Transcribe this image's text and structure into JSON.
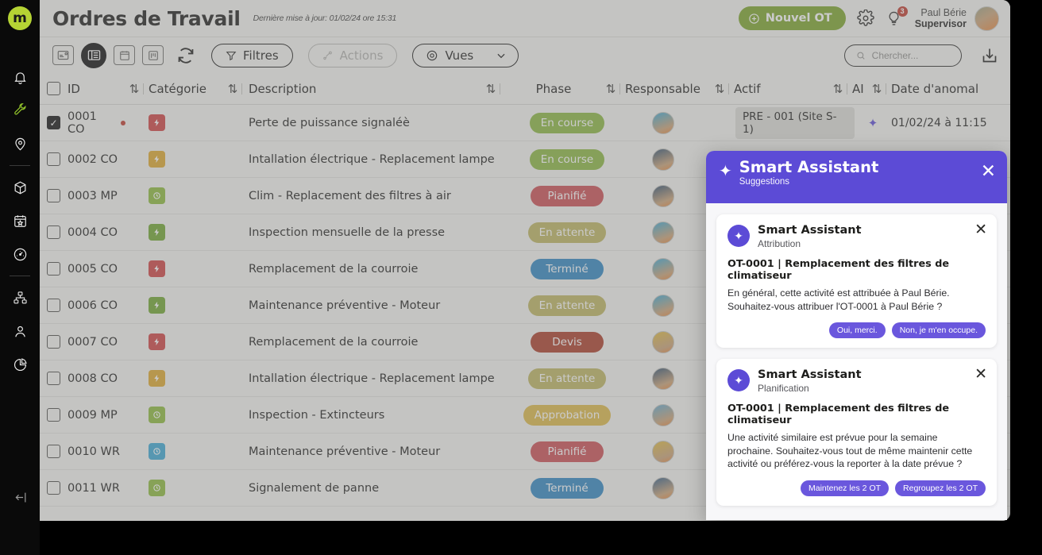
{
  "brand": {
    "logo_letter": "m",
    "accent_green": "#7ba428",
    "accent_purple": "#5c4bd6"
  },
  "sidebar": {
    "items": [
      {
        "name": "bell-icon",
        "label": "Notifications",
        "active": false
      },
      {
        "name": "wrench-icon",
        "label": "Maintenance",
        "active": true
      },
      {
        "name": "location-pin-icon",
        "label": "Sites",
        "active": false
      },
      {
        "name": "cube-icon",
        "label": "Actifs",
        "active": false
      },
      {
        "name": "calendar-star-icon",
        "label": "Planning",
        "active": false
      },
      {
        "name": "gauge-icon",
        "label": "Performance",
        "active": false
      },
      {
        "name": "hierarchy-icon",
        "label": "Organisation",
        "active": false
      },
      {
        "name": "user-icon",
        "label": "Utilisateurs",
        "active": false
      },
      {
        "name": "pie-chart-icon",
        "label": "Rapports",
        "active": false
      }
    ],
    "collapse_label": "Réduire"
  },
  "header": {
    "title": "Ordres de Travail",
    "subtitle": "Dernière mise à jour: 01/02/24 ore 15:31",
    "new_button": "Nouvel OT",
    "gear_icon": "gear-icon",
    "bulb_icon": "lightbulb-icon",
    "bulb_badge": "3",
    "user_name": "Paul Bérie",
    "user_role": "Supervisor"
  },
  "toolbar": {
    "views": [
      {
        "name": "card-view-icon",
        "active": false
      },
      {
        "name": "list-view-icon",
        "active": true
      },
      {
        "name": "calendar-view-icon",
        "active": false
      },
      {
        "name": "kanban-view-icon",
        "active": false
      }
    ],
    "refresh_icon": "refresh-icon",
    "filters_label": "Filtres",
    "actions_label": "Actions",
    "views_label": "Vues",
    "search_placeholder": "Chercher...",
    "search_value": "",
    "download_icon": "download-icon"
  },
  "table": {
    "columns": [
      {
        "key": "id",
        "label": "ID",
        "sortable": true
      },
      {
        "key": "category",
        "label": "Catégorie",
        "sortable": true
      },
      {
        "key": "description",
        "label": "Description",
        "sortable": true
      },
      {
        "key": "phase",
        "label": "Phase",
        "sortable": true
      },
      {
        "key": "responsable",
        "label": "Responsable",
        "sortable": true
      },
      {
        "key": "actif",
        "label": "Actif",
        "sortable": true
      },
      {
        "key": "ai",
        "label": "AI",
        "sortable": true
      },
      {
        "key": "date",
        "label": "Date d'anomal",
        "sortable": false
      }
    ],
    "select_all": false,
    "rows": [
      {
        "selected": true,
        "id": "0001 CO",
        "flag": true,
        "cat_icon": "bolt-icon",
        "cat_color": "#cf4040",
        "description": "Perte de puissance signaléè",
        "phase": "En course",
        "phase_color": "#8bb73f",
        "avatar_color": "#3aa8d4",
        "actif": "PRE - 001 (Site S-1)",
        "ai": true,
        "date": "01/02/24 à 11:15"
      },
      {
        "selected": false,
        "id": "0002 CO",
        "flag": false,
        "cat_icon": "bolt-icon",
        "cat_color": "#dfa82a",
        "description": "Intallation électrique - Replacement lampe",
        "phase": "En course",
        "phase_color": "#8bb73f",
        "avatar_color": "#2f4f6e",
        "actif": "",
        "ai": false,
        "date": ""
      },
      {
        "selected": false,
        "id": "0003 MP",
        "flag": false,
        "cat_icon": "clock-icon",
        "cat_color": "#8cbb3a",
        "description": "Clim - Replacement des filtres à air",
        "phase": "Pianifié",
        "phase_color": "#cb4c52",
        "avatar_color": "#2f4f6e",
        "actif": "",
        "ai": false,
        "date": ""
      },
      {
        "selected": false,
        "id": "0004 CO",
        "flag": false,
        "cat_icon": "bolt-icon",
        "cat_color": "#6fa52e",
        "description": "Inspection mensuelle de la presse",
        "phase": "En attente",
        "phase_color": "#bdb560",
        "avatar_color": "#3aa8d4",
        "actif": "",
        "ai": false,
        "date": ""
      },
      {
        "selected": false,
        "id": "0005 CO",
        "flag": false,
        "cat_icon": "bolt-icon",
        "cat_color": "#cf4040",
        "description": "Remplacement de la courroie",
        "phase": "Terminé",
        "phase_color": "#2e86c1",
        "avatar_color": "#3aa8d4",
        "actif": "",
        "ai": false,
        "date": ""
      },
      {
        "selected": false,
        "id": "0006 CO",
        "flag": false,
        "cat_icon": "bolt-icon",
        "cat_color": "#6fa52e",
        "description": "Maintenance préventive - Moteur",
        "phase": "En attente",
        "phase_color": "#bdb560",
        "avatar_color": "#3aa8d4",
        "actif": "",
        "ai": false,
        "date": ""
      },
      {
        "selected": false,
        "id": "0007 CO",
        "flag": false,
        "cat_icon": "bolt-icon",
        "cat_color": "#cf4040",
        "description": "Remplacement de la courroie",
        "phase": "Devis",
        "phase_color": "#ab3b26",
        "avatar_color": "#e0b93a",
        "actif": "",
        "ai": false,
        "date": ""
      },
      {
        "selected": false,
        "id": "0008 CO",
        "flag": false,
        "cat_icon": "bolt-icon",
        "cat_color": "#dfa82a",
        "description": "Intallation électrique - Replacement lampe",
        "phase": "En attente",
        "phase_color": "#bdb560",
        "avatar_color": "#2f4f6e",
        "actif": "",
        "ai": false,
        "date": ""
      },
      {
        "selected": false,
        "id": "0009 MP",
        "flag": false,
        "cat_icon": "clock-icon",
        "cat_color": "#8cbb3a",
        "description": "Inspection - Extincteurs",
        "phase": "Approbation",
        "phase_color": "#ddb846",
        "avatar_color": "#5fa8cf",
        "actif": "",
        "ai": false,
        "date": ""
      },
      {
        "selected": false,
        "id": "0010 WR",
        "flag": false,
        "cat_icon": "clock-icon",
        "cat_color": "#3aa8d4",
        "description": "Maintenance préventive - Moteur",
        "phase": "Pianifié",
        "phase_color": "#cb4c52",
        "avatar_color": "#e0b93a",
        "actif": "",
        "ai": false,
        "date": ""
      },
      {
        "selected": false,
        "id": "0011 WR",
        "flag": false,
        "cat_icon": "clock-icon",
        "cat_color": "#8cbb3a",
        "description": "Signalement de panne",
        "phase": "Terminé",
        "phase_color": "#2e86c1",
        "avatar_color": "#2e5a84",
        "actif": "",
        "ai": false,
        "date": ""
      }
    ]
  },
  "assistant": {
    "title": "Smart Assistant",
    "subtitle": "Suggestions",
    "close_icon": "close-icon",
    "cards": [
      {
        "name": "Smart Assistant",
        "kind": "Attribution",
        "subject": "OT-0001 | Remplacement des filtres de climatiseur",
        "text": "En général, cette activité est attribuée à Paul Bérie. Souhaitez-vous attribuer l'OT-0001 à Paul Bérie ?",
        "actions": [
          "Oui, merci.",
          "Non, je m'en occupe."
        ]
      },
      {
        "name": "Smart Assistant",
        "kind": "Planification",
        "subject": "OT-0001 | Remplacement des filtres de climatiseur",
        "text": "Une activité similaire est prévue pour la semaine prochaine. Souhaitez-vous tout de même maintenir cette activité ou préférez-vous la reporter à la date prévue ?",
        "actions": [
          "Maintenez les 2 OT",
          "Regroupez les 2 OT"
        ]
      }
    ]
  }
}
